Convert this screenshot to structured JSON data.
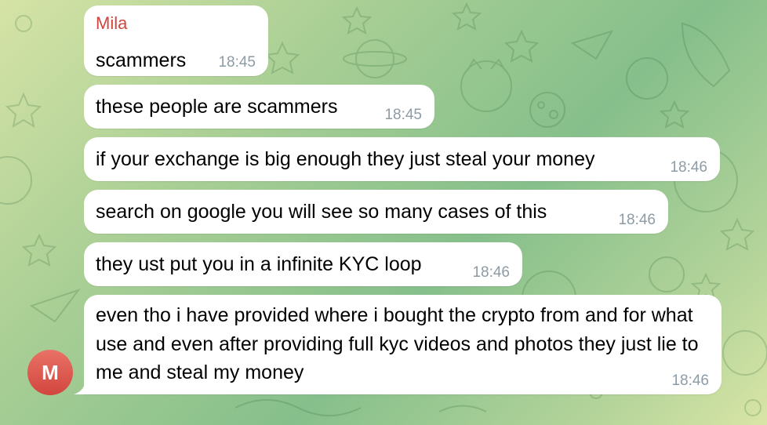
{
  "theme": {
    "sender_color": "#d0453d",
    "avatar_color": "#d2463f",
    "bubble_color": "#ffffff",
    "time_color": "#8d9ba4"
  },
  "messages": [
    {
      "sender": "Mila",
      "text": "scammers",
      "time": "18:45"
    },
    {
      "text": "these people are scammers",
      "time": "18:45"
    },
    {
      "text": "if your exchange is big enough they just steal your money",
      "time": "18:46"
    },
    {
      "text": "search on google you will see so many cases of this",
      "time": "18:46"
    },
    {
      "text": "they ust put you in a infinite KYC loop",
      "time": "18:46"
    },
    {
      "text": "even tho i have provided where i bought the crypto from and for what use and even after providing full kyc videos and photos they just lie to me and steal my money",
      "time": "18:46"
    }
  ],
  "avatar": {
    "initial": "M",
    "icon": "user-avatar"
  }
}
